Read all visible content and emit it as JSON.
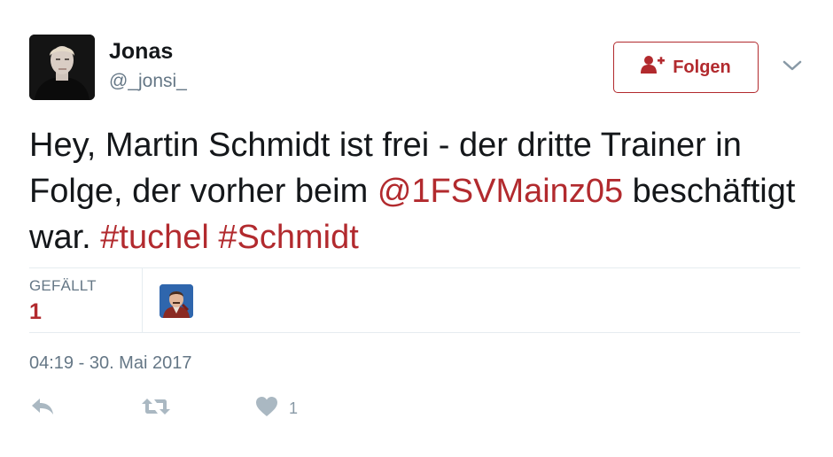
{
  "author": {
    "display_name": "Jonas",
    "handle": "@_jonsi_"
  },
  "follow_button": {
    "label": "Folgen",
    "icon": "follow-person-plus-icon",
    "color": "#b22a2e"
  },
  "menu": {
    "icon": "chevron-down-icon"
  },
  "tweet": {
    "text_1": "Hey, Martin Schmidt ist frei - der dritte Trainer in Folge, der vorher beim ",
    "mention": "@1FSVMainz05",
    "text_2": " beschäftigt war. ",
    "hashtag_1": "#tuchel",
    "text_3": " ",
    "hashtag_2": "#Schmidt",
    "link_color": "#b22a2e"
  },
  "stats": {
    "likes_label": "GEFÄLLT",
    "likes_count": "1"
  },
  "timestamp": "04:19 - 30. Mai 2017",
  "actions": {
    "reply_icon": "reply-icon",
    "retweet_icon": "retweet-icon",
    "like_icon": "heart-icon",
    "like_count": "1"
  }
}
